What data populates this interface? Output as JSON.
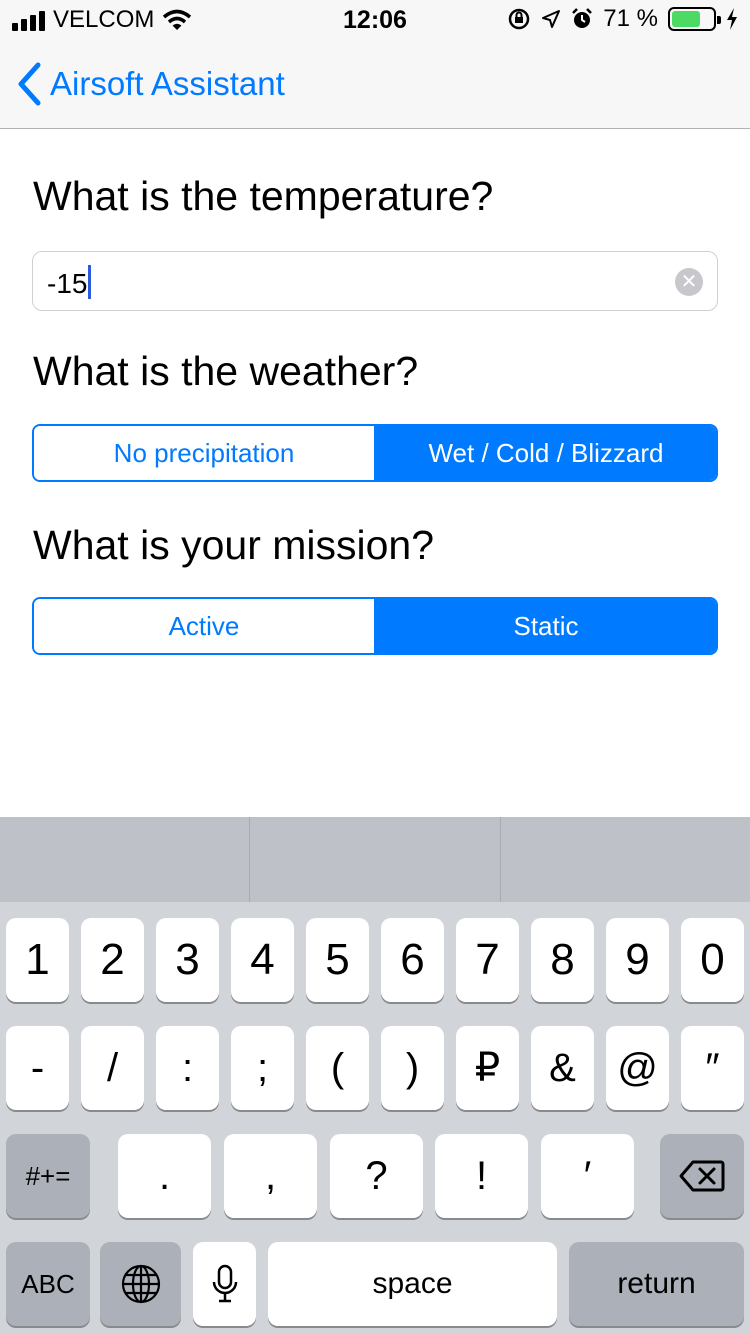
{
  "status_bar": {
    "carrier": "VELCOM",
    "time": "12:06",
    "battery_percent": "71 %",
    "battery_level": 0.71
  },
  "nav": {
    "back_label": "Airsoft Assistant"
  },
  "temperature": {
    "question": "What is the temperature?",
    "value": "-15"
  },
  "weather": {
    "question": "What is the weather?",
    "options": [
      "No precipitation",
      "Wet / Cold / Blizzard"
    ],
    "selected": "Wet / Cold / Blizzard"
  },
  "mission": {
    "question": "What is your mission?",
    "options": [
      "Active",
      "Static"
    ],
    "selected": "Static"
  },
  "keyboard": {
    "row1": [
      "1",
      "2",
      "3",
      "4",
      "5",
      "6",
      "7",
      "8",
      "9",
      "0"
    ],
    "row2": [
      "-",
      "/",
      ":",
      ";",
      "(",
      ")",
      "₽",
      "&",
      "@",
      "″"
    ],
    "row3": {
      "shift": "#+=",
      "keys": [
        ".",
        ",",
        "?",
        "!",
        "′"
      ]
    },
    "row4": {
      "abc": "ABC",
      "space": "space",
      "return": "return"
    }
  },
  "colors": {
    "accent": "#007aff",
    "keyboard_bg": "#d1d4d9",
    "battery_green": "#4cd964"
  }
}
